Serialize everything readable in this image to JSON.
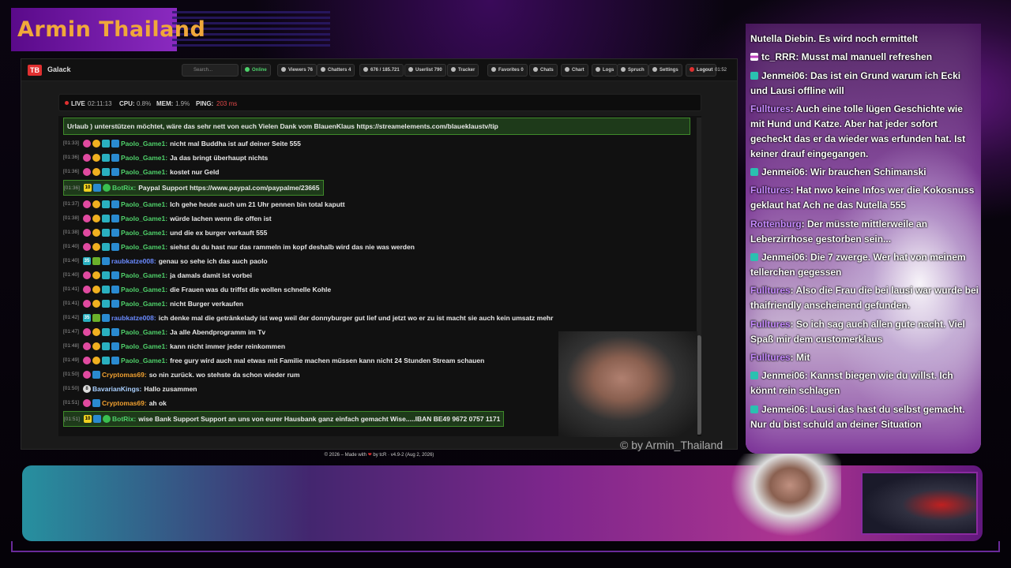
{
  "stream_title": "Armin Thailand",
  "app": {
    "brand": "Galack",
    "logo": "TB",
    "search_placeholder": "Search..."
  },
  "nav": {
    "online": "Online",
    "viewers": "Viewers 76",
    "chatters": "Chatters 4",
    "messages": "676 / 185.721",
    "userlist": "Userlist 790",
    "tracker": "Tracker",
    "favorites": "Favorites 0",
    "chats": "Chats",
    "chart": "Chart",
    "logs": "Logs",
    "spruch": "Spruch",
    "settings": "Settings",
    "logout": "Logout",
    "clock": "01:52"
  },
  "status": {
    "live": "LIVE",
    "live_time": "02:11:13",
    "cpu_label": "CPU:",
    "cpu": "0.8%",
    "mem_label": "MEM:",
    "mem": "1.9%",
    "ping_label": "PING:",
    "ping": "203 ms"
  },
  "pinned": "Urlaub ) unterstützen möchtet, wäre das sehr nett von euch Vielen Dank vom BlauenKlaus https://streamelements.com/blaueklaustv/tip",
  "messages": [
    {
      "ts": "[01:33]",
      "user": "Paolo_Game1:",
      "text": "nicht mal Buddha ist auf deiner Seite 555"
    },
    {
      "ts": "[01:36]",
      "user": "Paolo_Game1:",
      "text": "Ja das bringt überhaupt nichts"
    },
    {
      "ts": "[01:36]",
      "user": "Paolo_Game1:",
      "text": "kostet nur Geld"
    },
    {
      "ts": "[01:36]",
      "user": "BotRix:",
      "text": "Paypal Support https://www.paypal.com/paypalme/23665"
    },
    {
      "ts": "[01:37]",
      "user": "Paolo_Game1:",
      "text": "Ich gehe heute auch um 21 Uhr pennen bin total kaputt"
    },
    {
      "ts": "[01:38]",
      "user": "Paolo_Game1:",
      "text": "würde lachen wenn die offen ist"
    },
    {
      "ts": "[01:38]",
      "user": "Paolo_Game1:",
      "text": "und die ex burger verkauft 555"
    },
    {
      "ts": "[01:40]",
      "user": "Paolo_Game1:",
      "text": "siehst du du hast nur das rammeln im kopf deshalb wird das nie was werden"
    },
    {
      "ts": "[01:40]",
      "user": "raubkatze008:",
      "text": "genau so sehe ich das auch paolo"
    },
    {
      "ts": "[01:40]",
      "user": "Paolo_Game1:",
      "text": "ja damals damit ist vorbei"
    },
    {
      "ts": "[01:41]",
      "user": "Paolo_Game1:",
      "text": "die Frauen was du triffst die wollen schnelle Kohle"
    },
    {
      "ts": "[01:41]",
      "user": "Paolo_Game1:",
      "text": "nicht Burger verkaufen"
    },
    {
      "ts": "[01:42]",
      "user": "raubkatze008:",
      "text": "ich denke mal die getränkelady ist weg weil der donnyburger gut lief und jetzt wo er zu ist macht sie auch kein umsatz mehr"
    },
    {
      "ts": "[01:47]",
      "user": "Paolo_Game1:",
      "text": "Ja alle Abendprogramm im Tv"
    },
    {
      "ts": "[01:48]",
      "user": "Paolo_Game1:",
      "text": "kann nicht immer jeder reinkommen"
    },
    {
      "ts": "[01:49]",
      "user": "Paolo_Game1:",
      "text": "free gury wird auch mal etwas mit Familie machen müssen kann nicht 24 Stunden Stream schauen"
    },
    {
      "ts": "[01:50]",
      "user": "Cryptomas69:",
      "text": "so nin zurück. wo stehste da schon wieder rum"
    },
    {
      "ts": "[01:50]",
      "user": "BavarianKings:",
      "text": "Hallo zusammen"
    },
    {
      "ts": "[01:51]",
      "user": "Cryptomas69:",
      "text": "ah ok"
    },
    {
      "ts": "[01:51]",
      "user": "BotRix:",
      "text": "wise Bank Support Support an uns von eurer Hausbank ganz einfach gemacht Wise.....IBAN BE49 9672 0757 1171"
    }
  ],
  "badges": {
    "raub": "35",
    "bot": "10",
    "bav": "8"
  },
  "footer": {
    "pre": "© 2026 – Made with",
    "heart": "❤",
    "post": "by tcR · v4.9-2 (Aug 2, 2026)"
  },
  "watermark": "© by Armin_Thailand",
  "right_chat": [
    {
      "user": "Nutella Diebin. Es wird noch ermittelt",
      "text": ""
    },
    {
      "user": "tc_RRR",
      "text": ": Musst mal manuell refreshen"
    },
    {
      "user": "Jenmei06",
      "text": ": Das ist ein Grund warum ich Ecki und Lausi offline will"
    },
    {
      "user": "Fulltures",
      "text": ": Auch eine tolle lügen Geschichte wie mit Hund und Katze. Aber hat jeder sofort gecheckt das er da wieder was erfunden hat. Ist keiner drauf eingegangen."
    },
    {
      "user": "Jenmei06",
      "text": ": Wir brauchen Schimanski"
    },
    {
      "user": "Fulltures",
      "text": ": Hat nwo keine Infos wer die Kokosnuss geklaut hat Ach ne das Nutella 555"
    },
    {
      "user": "Rottenburg",
      "text": ": Der müsste mittlerweile an Leberzirrhose gestorben sein..."
    },
    {
      "user": "Jenmei06",
      "text": ": Die 7 zwerge. Wer hat von meinem tellerchen gegessen"
    },
    {
      "user": "Fulltures",
      "text": ": Also die Frau die bei lausi war wurde bei thaifriendly anscheinend gefunden."
    },
    {
      "user": "Fulltures",
      "text": ": So ich sag auch allen gute nacht. Viel Spaß mir dem customerklaus"
    },
    {
      "user": "Fulltures",
      "text": ": Mit"
    },
    {
      "user": "Jenmei06",
      "text": ": Kannst biegen wie du willst. Ich könnt rein schlagen"
    },
    {
      "user": "Jenmei06",
      "text": ": Lausi das hast du selbst gemacht. Nur du bist schuld an deiner Situation"
    }
  ],
  "colors": {
    "accent": "#4fd06a",
    "brand_title": "#f0a83a",
    "name_purple": "#c68aff",
    "ping": "#e04848"
  }
}
